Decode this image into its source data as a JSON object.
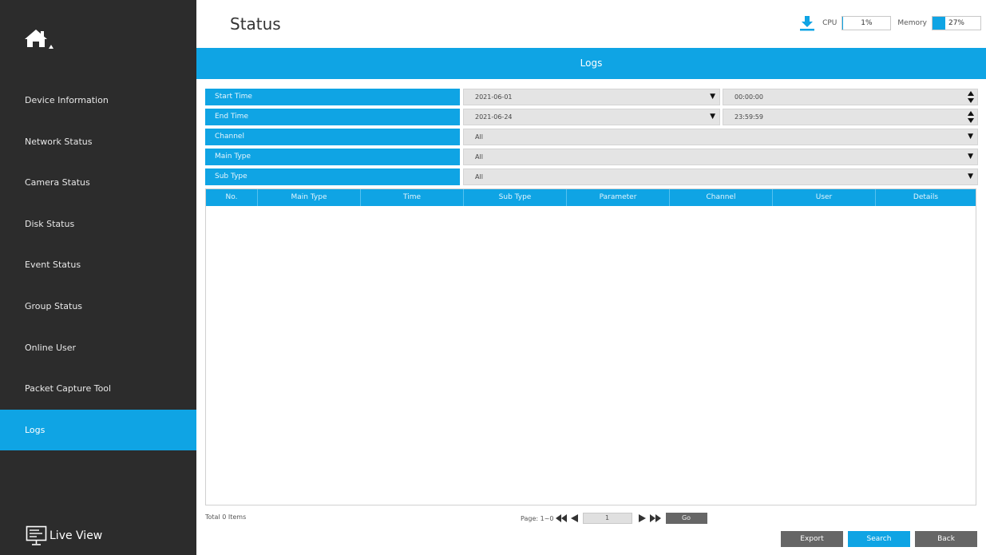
{
  "header": {
    "title": "Status"
  },
  "system": {
    "cpu_label": "CPU",
    "cpu_value": "1%",
    "cpu_fraction": 0.01,
    "memory_label": "Memory",
    "memory_value": "27%",
    "memory_fraction": 0.27
  },
  "sidebar": {
    "items": [
      {
        "label": "Device Information"
      },
      {
        "label": "Network Status"
      },
      {
        "label": "Camera Status"
      },
      {
        "label": "Disk Status"
      },
      {
        "label": "Event Status"
      },
      {
        "label": "Group Status"
      },
      {
        "label": "Online User"
      },
      {
        "label": "Packet Capture Tool"
      },
      {
        "label": "Logs"
      }
    ],
    "active": "Logs",
    "live_view": "Live View"
  },
  "panel": {
    "title": "Logs"
  },
  "filters": {
    "start_time": {
      "label": "Start Time",
      "date": "2021-06-01",
      "time": "00:00:00"
    },
    "end_time": {
      "label": "End Time",
      "date": "2021-06-24",
      "time": "23:59:59"
    },
    "channel": {
      "label": "Channel",
      "value": "All"
    },
    "main_type": {
      "label": "Main Type",
      "value": "All"
    },
    "sub_type": {
      "label": "Sub Type",
      "value": "All"
    }
  },
  "table": {
    "columns": [
      "No.",
      "Main Type",
      "Time",
      "Sub Type",
      "Parameter",
      "Channel",
      "User",
      "Details"
    ],
    "rows": []
  },
  "footer": {
    "total": "Total 0 Items",
    "page_label": "Page: 1~0",
    "page_input": "1",
    "go": "Go"
  },
  "buttons": {
    "export": "Export",
    "search": "Search",
    "back": "Back"
  },
  "colors": {
    "accent": "#0fa4e4",
    "sidebar": "#2c2c2c",
    "button_gray": "#666666"
  }
}
